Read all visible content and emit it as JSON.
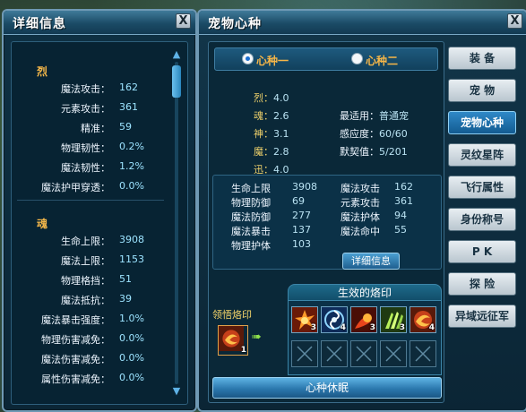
{
  "detail_panel": {
    "title": "详细信息",
    "close": "X",
    "section1": {
      "heading": "烈",
      "rows": [
        {
          "label": "魔法攻击：",
          "value": "162"
        },
        {
          "label": "元素攻击：",
          "value": "361"
        },
        {
          "label": "精准：",
          "value": "59"
        },
        {
          "label": "物理韧性：",
          "value": "0.2%"
        },
        {
          "label": "魔法韧性：",
          "value": "1.2%"
        },
        {
          "label": "魔法护甲穿透：",
          "value": "0.0%"
        }
      ]
    },
    "section2": {
      "heading": "魂",
      "rows": [
        {
          "label": "生命上限：",
          "value": "3908"
        },
        {
          "label": "魔法上限：",
          "value": "1153"
        },
        {
          "label": "物理格挡：",
          "value": "51"
        },
        {
          "label": "魔法抵抗：",
          "value": "39"
        },
        {
          "label": "魔法暴击强度：",
          "value": "1.0%"
        },
        {
          "label": "物理伤害减免：",
          "value": "0.0%"
        },
        {
          "label": "魔法伤害减免：",
          "value": "0.0%"
        },
        {
          "label": "属性伤害减免：",
          "value": "0.0%"
        }
      ]
    }
  },
  "pet_panel": {
    "title": "宠物心种",
    "close": "X",
    "seed_tabs": [
      "心种一",
      "心种二"
    ],
    "attrs": [
      {
        "k": "烈：",
        "v": "4.0"
      },
      {
        "k": "魂：",
        "v": "2.6"
      },
      {
        "k": "神：",
        "v": "3.1"
      },
      {
        "k": "魔：",
        "v": "2.8"
      },
      {
        "k": "迅：",
        "v": "4.0"
      }
    ],
    "info": [
      {
        "k": "最适用：",
        "v": "普通宠"
      },
      {
        "k": "感应度：",
        "v": "60/60"
      },
      {
        "k": "默契值：",
        "v": "5/201"
      }
    ],
    "combat_left": [
      {
        "l": "生命上限",
        "n": "3908"
      },
      {
        "l": "物理防御",
        "n": "69"
      },
      {
        "l": "魔法防御",
        "n": "277"
      },
      {
        "l": "魔法暴击",
        "n": "137"
      },
      {
        "l": "物理护体",
        "n": "103"
      }
    ],
    "combat_right": [
      {
        "l": "魔法攻击",
        "n": "162"
      },
      {
        "l": "元素攻击",
        "n": "361"
      },
      {
        "l": "魔法护体",
        "n": "94"
      },
      {
        "l": "魔法命中",
        "n": "55"
      }
    ],
    "detail_button": "详细信息",
    "learn_label": "领悟烙印",
    "learn_slot_level": "1",
    "effect_title": "生效的烙印",
    "seals": [
      {
        "icon": "fire-burst-seal-icon",
        "level": "3"
      },
      {
        "icon": "vortex-seal-icon",
        "level": "4"
      },
      {
        "icon": "fireball-seal-icon",
        "level": "3"
      },
      {
        "icon": "claw-seal-icon",
        "level": "3"
      },
      {
        "icon": "fire-swirl-seal-icon",
        "level": "4"
      }
    ],
    "dormant_button": "心种休眠"
  },
  "side_tabs": [
    "装 备",
    "宠 物",
    "宠物心种",
    "灵纹星阵",
    "飞行属性",
    "身份称号",
    "P K",
    "探 险",
    "异域远征军"
  ],
  "active_side_tab": "宠物心种",
  "colors": {
    "accent": "#f6b648",
    "value": "#9ce3ff",
    "panel": "#0b2636"
  }
}
